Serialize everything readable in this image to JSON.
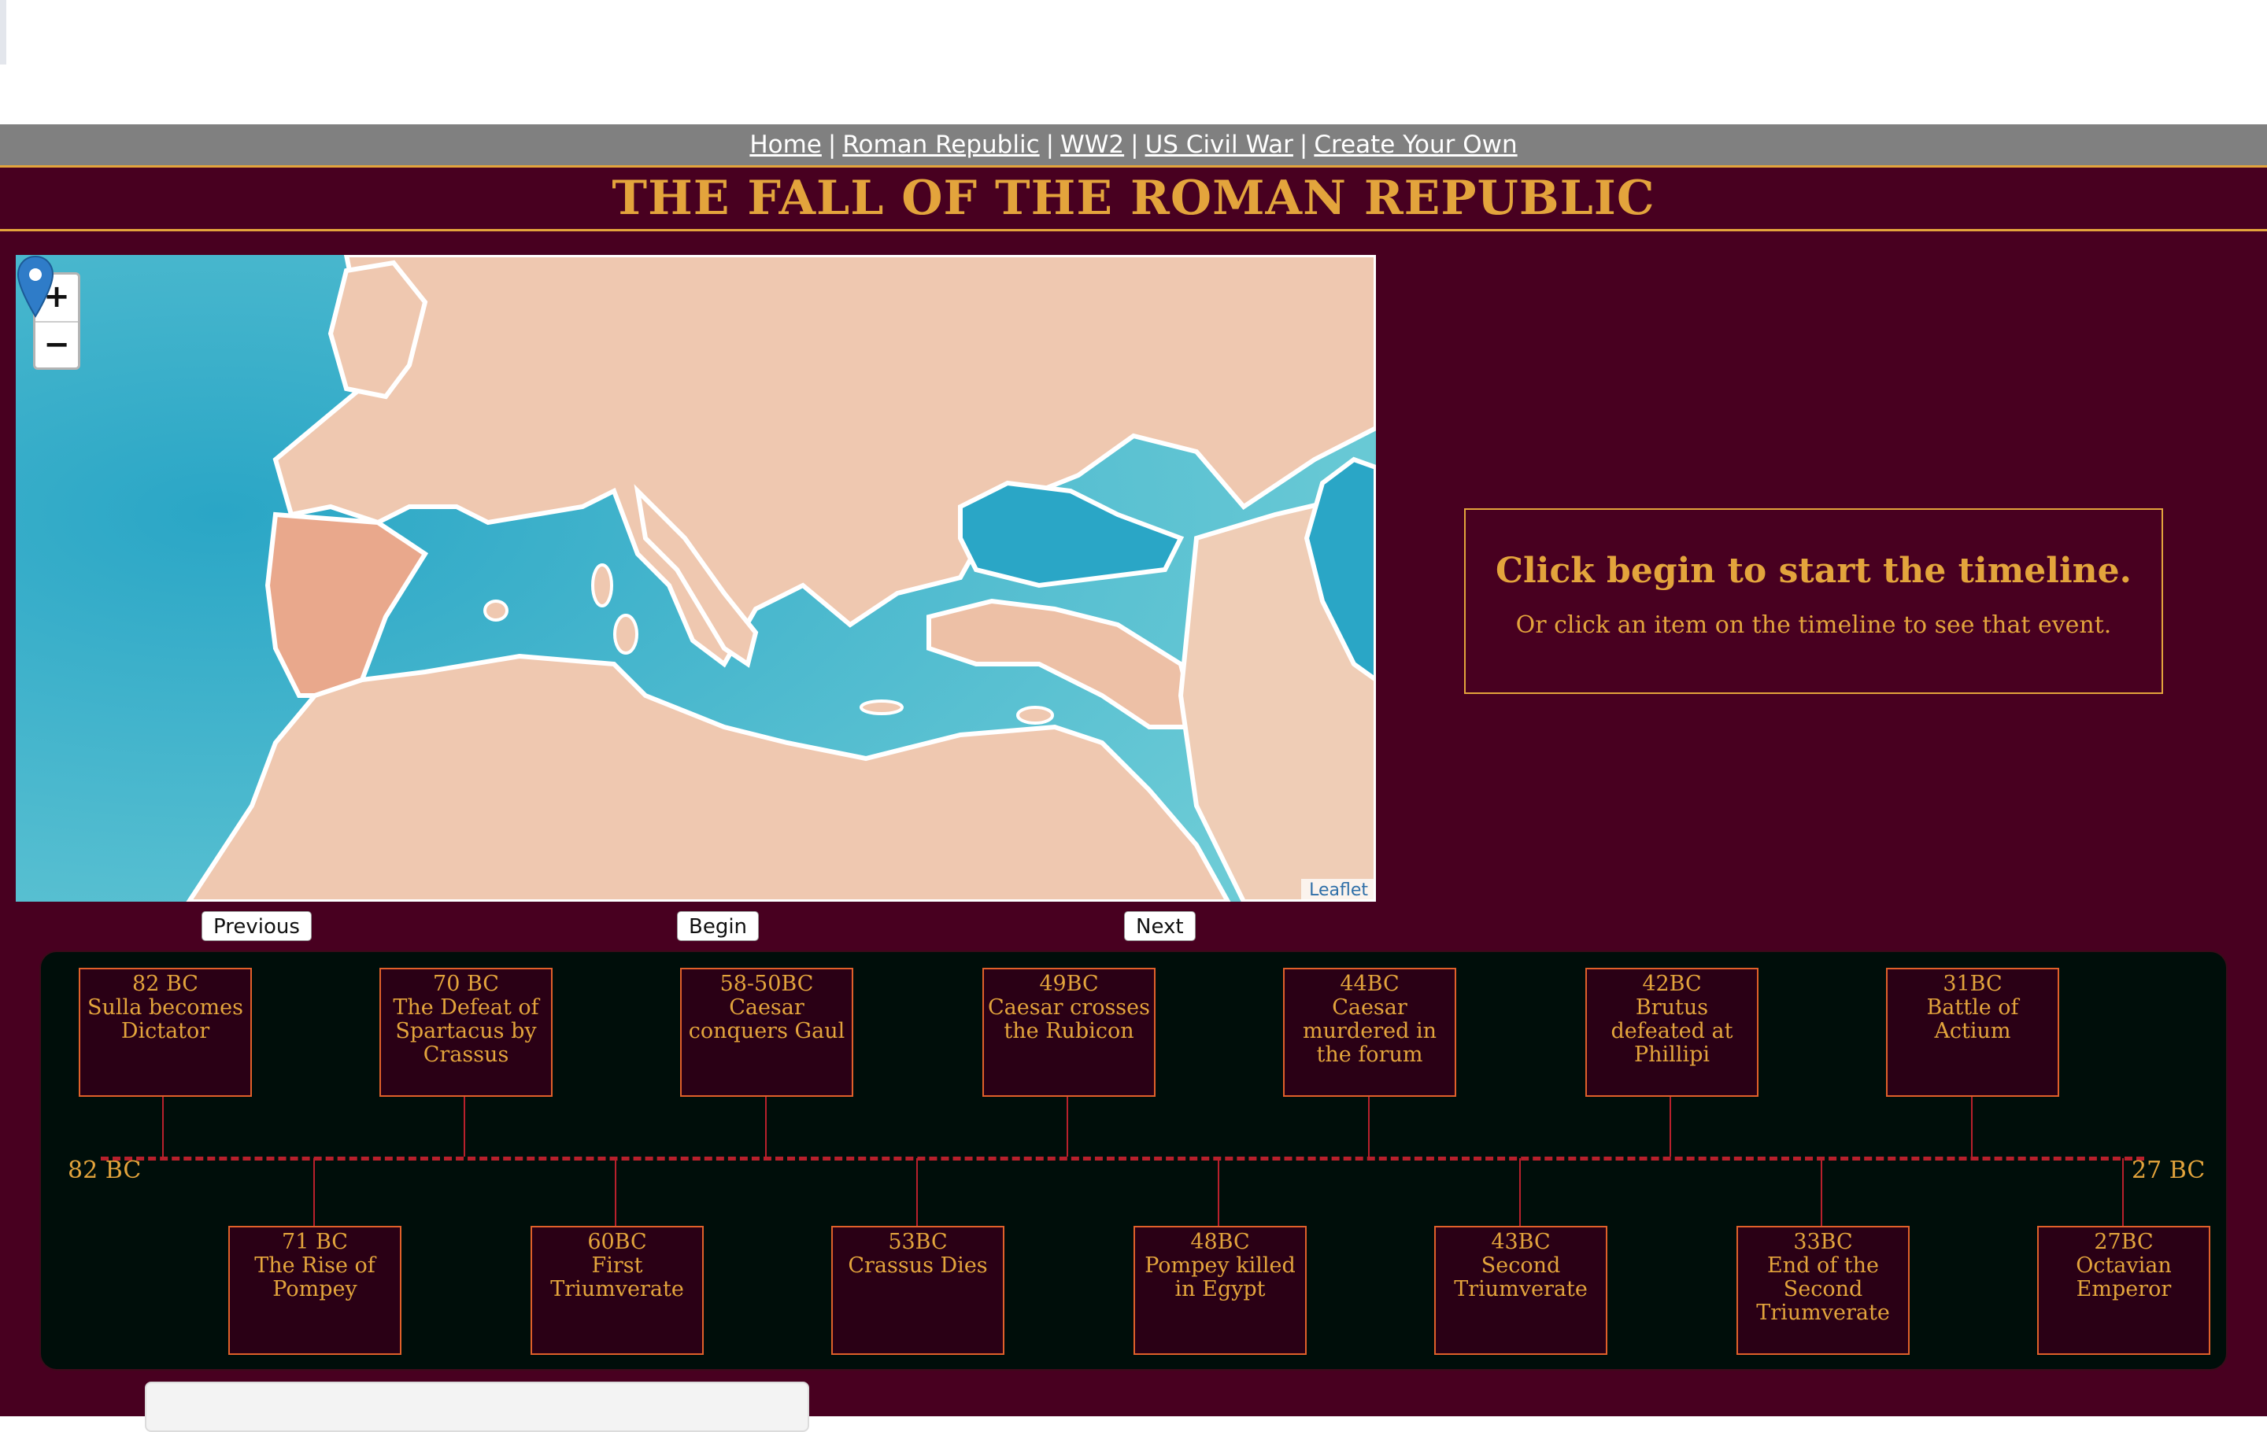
{
  "nav": {
    "links": [
      "Home",
      "Roman Republic",
      "WW2",
      "US Civil War",
      "Create Your Own"
    ],
    "separator": "|"
  },
  "title": "THE FALL OF THE ROMAN REPUBLIC",
  "map": {
    "zoom_in": "+",
    "zoom_out": "−",
    "attribution": "Leaflet"
  },
  "controls": {
    "previous": "Previous",
    "begin": "Begin",
    "next": "Next"
  },
  "info": {
    "heading": "Click begin to start the timeline.",
    "text": "Or click an item on the timeline to see that event."
  },
  "timeline": {
    "start_label": "82 BC",
    "end_label": "27 BC",
    "events": [
      {
        "date": "82 BC",
        "title": "Sulla becomes Dictator"
      },
      {
        "date": "71 BC",
        "title": "The Rise of Pompey"
      },
      {
        "date": "70 BC",
        "title": "The Defeat of Spartacus by Crassus"
      },
      {
        "date": "60BC",
        "title": "First Triumverate"
      },
      {
        "date": "58-50BC",
        "title": "Caesar conquers Gaul"
      },
      {
        "date": "53BC",
        "title": "Crassus Dies"
      },
      {
        "date": "49BC",
        "title": "Caesar crosses the Rubicon"
      },
      {
        "date": "48BC",
        "title": "Pompey killed in Egypt"
      },
      {
        "date": "44BC",
        "title": "Caesar murdered in the forum"
      },
      {
        "date": "43BC",
        "title": "Second Triumverate"
      },
      {
        "date": "42BC",
        "title": "Brutus defeated at Phillipi"
      },
      {
        "date": "33BC",
        "title": "End of the Second Triumverate"
      },
      {
        "date": "31BC",
        "title": "Battle of Actium"
      },
      {
        "date": "27BC",
        "title": "Octavian Emperor"
      }
    ]
  },
  "colors": {
    "background": "#480020",
    "accent": "#e3a43c",
    "nav_bar": "#808080",
    "timeline_bg": "#000e0a",
    "event_border": "#e0602a",
    "axis": "#b8202c"
  }
}
